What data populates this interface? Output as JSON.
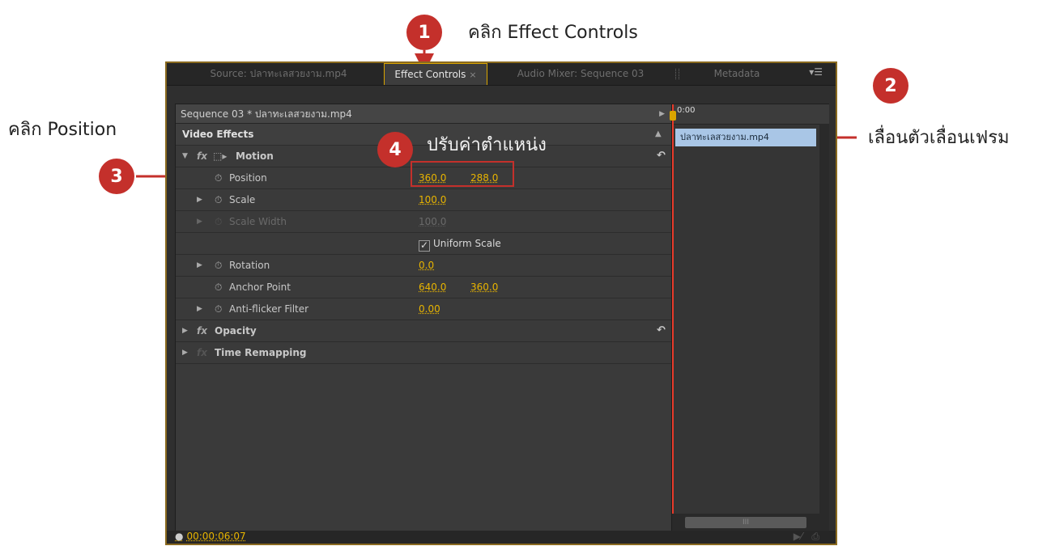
{
  "annotations": [
    {
      "number": "1",
      "text": "คลิก Effect Controls"
    },
    {
      "number": "2",
      "text": "เลื่อนตัวเลื่อนเฟรม"
    },
    {
      "number": "3",
      "text": "คลิก Position"
    },
    {
      "number": "4",
      "text": "ปรับค่าตำแหน่ง"
    }
  ],
  "colors": {
    "badge": "#c4302b",
    "value": "#e8b400",
    "clip": "#a9c6e6",
    "playhead_line": "#e83a2a",
    "panel_border": "#8a6a1f"
  },
  "tabs": [
    {
      "label": "Source: ปลาทะเลสวยงาม.mp4"
    },
    {
      "label": "Effect Controls",
      "close": "×"
    },
    {
      "label": "Audio Mixer: Sequence 03"
    },
    {
      "label": "Metadata"
    }
  ],
  "panel_menu_icon": "panel-menu-icon",
  "sequence_label": "Sequence 03 * ปลาทะเลสวยงาม.mp4",
  "video_effects_label": "Video Effects",
  "effects": {
    "motion": {
      "label": "Motion"
    },
    "position": {
      "label": "Position",
      "x": "360.0",
      "y": "288.0"
    },
    "scale": {
      "label": "Scale",
      "value": "100.0"
    },
    "scale_width": {
      "label": "Scale Width",
      "value": "100.0"
    },
    "uniform_scale": {
      "label": "Uniform Scale",
      "checked": true
    },
    "rotation": {
      "label": "Rotation",
      "value": "0.0"
    },
    "anchor_point": {
      "label": "Anchor Point",
      "x": "640.0",
      "y": "360.0"
    },
    "anti_flicker": {
      "label": "Anti-flicker Filter",
      "value": "0.00"
    },
    "opacity": {
      "label": "Opacity"
    },
    "time_remapping": {
      "label": "Time Remapping"
    }
  },
  "timeline": {
    "time_label": "0:00",
    "clip_label": "ปลาทะเลสวยงาม.mp4",
    "scroll_thumb": "III"
  },
  "timecode": "00:00:06:07"
}
